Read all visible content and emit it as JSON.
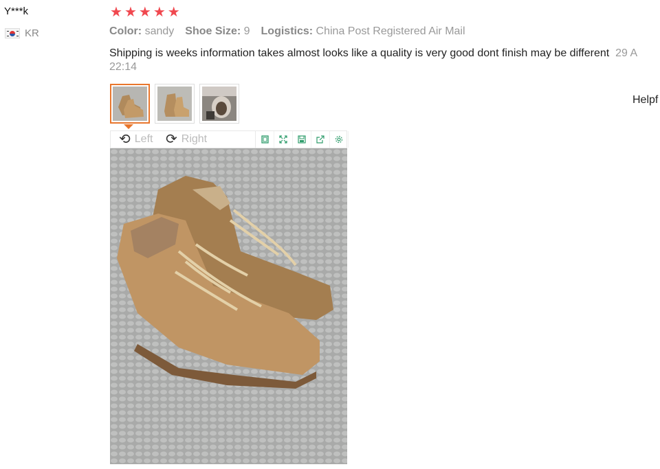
{
  "reviewer": {
    "name": "Y***k",
    "country": "KR"
  },
  "rating": {
    "stars": 5
  },
  "attributes": [
    {
      "label": "Color:",
      "value": "sandy"
    },
    {
      "label": "Shoe Size:",
      "value": "9"
    },
    {
      "label": "Logistics:",
      "value": "China Post Registered Air Mail"
    }
  ],
  "review": {
    "text": "Shipping is weeks information takes almost looks like a quality is very good dont finish may be different",
    "date_partial": "29 A",
    "time": "22:14"
  },
  "helpful_label": "Helpf",
  "viewer": {
    "rotate_left": "Left",
    "rotate_right": "Right",
    "tools": [
      "fit-icon",
      "fullscreen-icon",
      "save-icon",
      "share-icon",
      "settings-icon"
    ]
  },
  "colors": {
    "star": "#f0484f",
    "accent": "#e8762c",
    "tool": "#2e9c6b"
  }
}
